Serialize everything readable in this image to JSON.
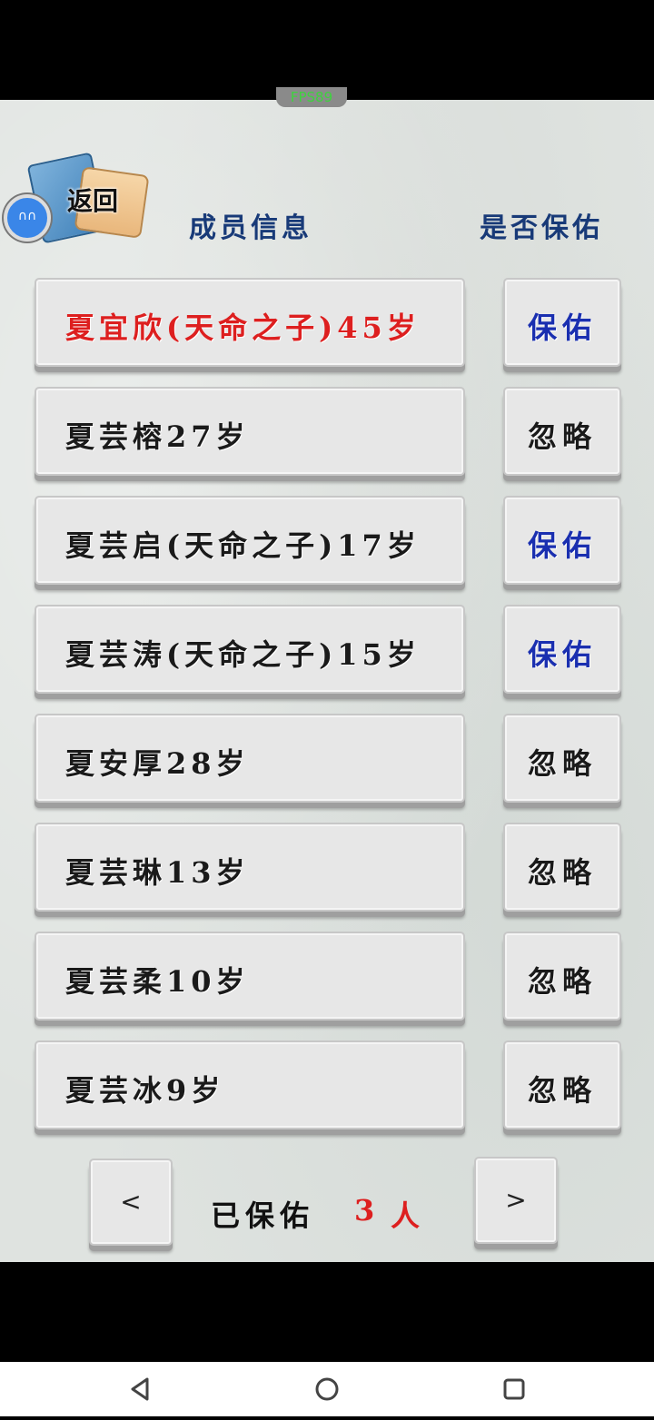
{
  "fps": "FPS89",
  "back": {
    "label": "返回",
    "badge": "∩∩"
  },
  "headers": {
    "info": "成员信息",
    "bless": "是否保佑"
  },
  "members": [
    {
      "name": "夏宜欣(天命之子)45岁",
      "action": "保佑",
      "highlight": true,
      "blessed": true
    },
    {
      "name": "夏芸榕27岁",
      "action": "忽略",
      "highlight": false,
      "blessed": false
    },
    {
      "name": "夏芸启(天命之子)17岁",
      "action": "保佑",
      "highlight": false,
      "blessed": true
    },
    {
      "name": "夏芸涛(天命之子)15岁",
      "action": "保佑",
      "highlight": false,
      "blessed": true
    },
    {
      "name": "夏安厚28岁",
      "action": "忽略",
      "highlight": false,
      "blessed": false
    },
    {
      "name": "夏芸琳13岁",
      "action": "忽略",
      "highlight": false,
      "blessed": false
    },
    {
      "name": "夏芸柔10岁",
      "action": "忽略",
      "highlight": false,
      "blessed": false
    },
    {
      "name": "夏芸冰9岁",
      "action": "忽略",
      "highlight": false,
      "blessed": false
    }
  ],
  "pager": {
    "prev": "<",
    "next": ">"
  },
  "footer": {
    "label": "已保佑",
    "count": "3",
    "unit": "人"
  },
  "colors": {
    "highlight_name": "#dd1f1f",
    "bless_action": "#1a2fb0",
    "header": "#183a78"
  },
  "nav": {
    "back_icon": "triangle-back-icon",
    "home_icon": "circle-home-icon",
    "recents_icon": "square-recents-icon"
  }
}
